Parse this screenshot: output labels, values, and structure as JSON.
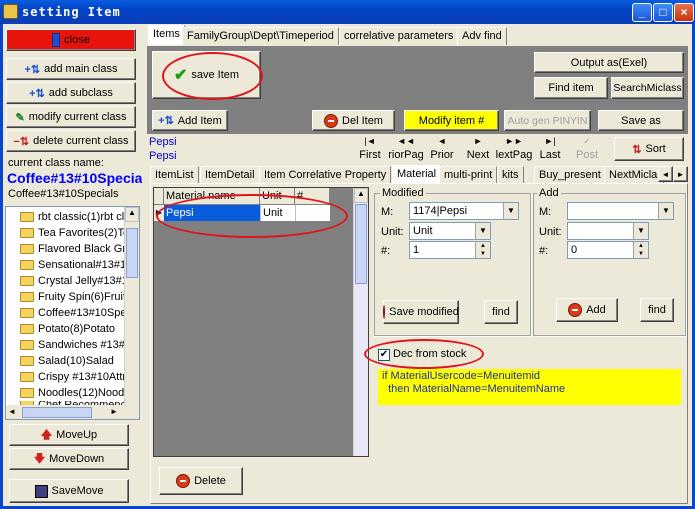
{
  "window": {
    "title": "setting Item"
  },
  "left": {
    "close_label": "close",
    "add_main_class": "add main class",
    "add_subclass": "add subclass",
    "modify_current_class": "modify current class",
    "delete_current_class": "delete current class",
    "current_class_caption": "current class name:",
    "current_class_big": "Coffee#13#10Specia",
    "current_class_small": "Coffee#13#10Specials",
    "tree": [
      "rbt classic(1)rbt cl",
      "Tea Favorites(2)Te",
      "Flavored Black Gre",
      "Sensational#13#1",
      "Crystal Jelly#13#1",
      "Fruity Spin(6)Fruity",
      "Coffee#13#10Spe",
      "Potato(8)Potato",
      "Sandwiches #13#",
      "Salad(10)Salad",
      "Crispy #13#10Attr",
      "Noodles(12)Nood",
      "Chef Recommenc"
    ],
    "move_up": "MoveUp",
    "move_down": "MoveDown",
    "save_move": "SaveMove"
  },
  "top_tabs": [
    "Items",
    "FamilyGroup\\Dept\\Timeperiod",
    "correlative parameters",
    "Adv find"
  ],
  "toolbar": {
    "save_item": "save Item",
    "output_exel": "Output as(Exel)",
    "find_item": "Find item",
    "search_miclass": "SearchMiclass",
    "add_item": "Add Item",
    "del_item": "Del Item",
    "modify_item": "Modify item #",
    "auto_gen": "Auto gen PINYIN",
    "save_as": "Save as"
  },
  "item": {
    "name1": "Pepsi",
    "name2": "Pepsi"
  },
  "nav": [
    {
      "glyph": "|◄",
      "label": "First"
    },
    {
      "glyph": "◄◄",
      "label": "riorPag"
    },
    {
      "glyph": "◄",
      "label": "Prior"
    },
    {
      "glyph": "►",
      "label": "Next"
    },
    {
      "glyph": "►►",
      "label": "lextPag"
    },
    {
      "glyph": "►|",
      "label": "Last"
    },
    {
      "glyph": "✓",
      "label": "Post"
    }
  ],
  "sort_label": "Sort",
  "sub_tabs": [
    "ItemList",
    "ItemDetail",
    "Item Correlative Property",
    "Material",
    "multi-print",
    "kits",
    "Buy_present",
    "NextMiclas"
  ],
  "grid": {
    "headers": [
      "Material name",
      "Unit",
      "#"
    ],
    "rows": [
      [
        "Pepsi",
        "Unit",
        ""
      ]
    ]
  },
  "modified": {
    "title": "Modified",
    "m_label": "M:",
    "m_value": "1174|Pepsi",
    "unit_label": "Unit:",
    "unit_value": "Unit",
    "num_label": "#:",
    "num_value": "1",
    "save_btn": "Save modified",
    "find_btn": "find"
  },
  "add": {
    "title": "Add",
    "m_label": "M:",
    "m_value": "",
    "unit_label": "Unit:",
    "unit_value": "",
    "num_label": "#:",
    "num_value": "0",
    "add_btn": "Add",
    "find_btn": "find"
  },
  "dec_from_stock": {
    "label": "Dec from stock",
    "checked": true
  },
  "note": {
    "line1": "if MaterialUsercode=Menuitemid",
    "line2": "  then MaterialName=MenuitemName"
  },
  "delete_label": "Delete",
  "colors": {
    "title_bar": "#0a5cde",
    "close_red": "#e8140c",
    "modify_yellow": "#ffff00",
    "class_name_blue": "#0000ff",
    "grid_select": "#0a5cde",
    "highlight_red": "#e0141c"
  }
}
